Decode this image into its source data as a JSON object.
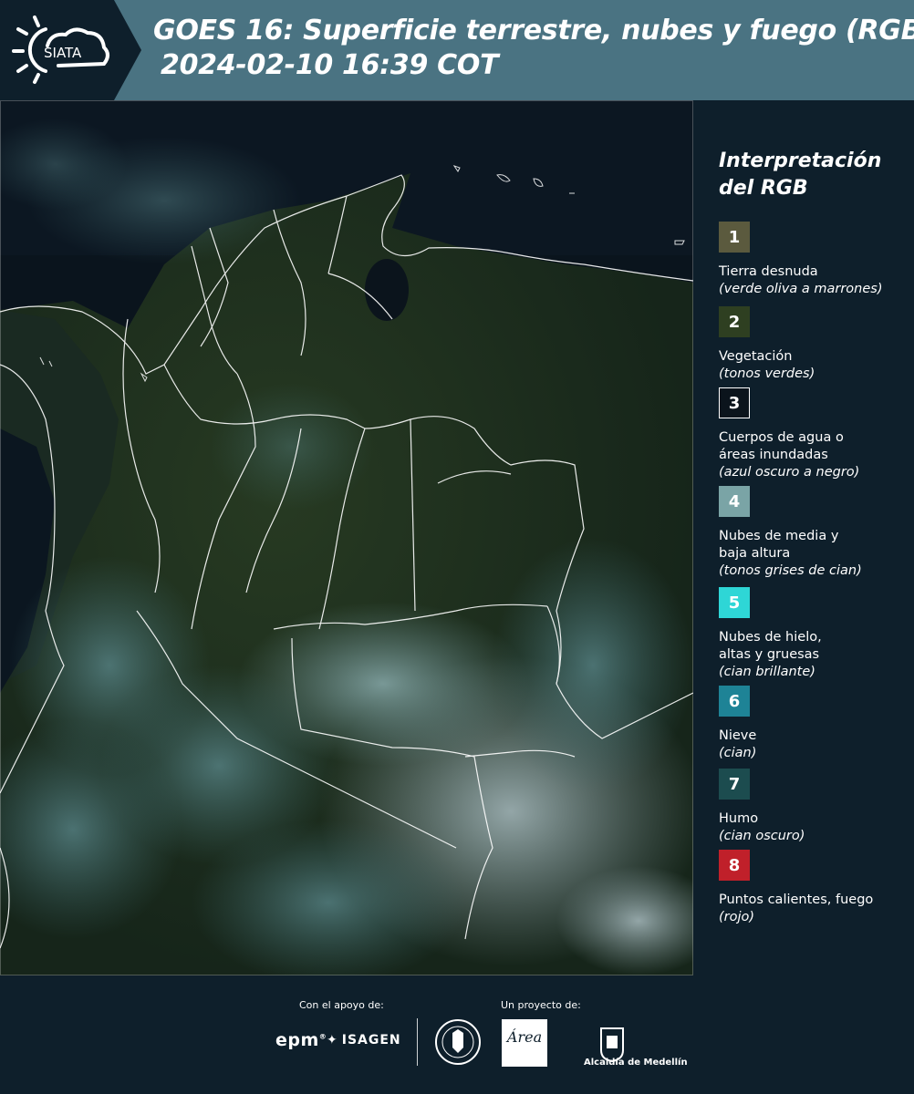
{
  "header": {
    "logo_text": "SIATA",
    "title_line1": "GOES 16: Superficie terrestre, nubes y fuego (RGB)",
    "title_line2": "2024-02-10 16:39 COT"
  },
  "legend": {
    "title_line1": "Interpretación",
    "title_line2": "del RGB",
    "items": [
      {
        "number": "1",
        "label": "Tierra desnuda",
        "note": "(verde oliva a marrones)",
        "color": "#5b5a3e",
        "border": "none"
      },
      {
        "number": "2",
        "label": "Vegetación",
        "note": "(tonos verdes)",
        "color": "#2e3f21",
        "border": "none"
      },
      {
        "number": "3",
        "label": "Cuerpos de agua o\náreas inundadas",
        "note": "(azul oscuro a negro)",
        "color": "#0b141c",
        "border": "#ffffff"
      },
      {
        "number": "4",
        "label": "Nubes de media y\nbaja altura",
        "note": "(tonos grises de cian)",
        "color": "#7aa4a6",
        "border": "none"
      },
      {
        "number": "5",
        "label": "Nubes de hielo,\naltas y gruesas",
        "note": "(cian brillante)",
        "color": "#2ed6d6",
        "border": "none"
      },
      {
        "number": "6",
        "label": "Nieve",
        "note": "(cian)",
        "color": "#1e8396",
        "border": "none"
      },
      {
        "number": "7",
        "label": "Humo",
        "note": "(cian oscuro)",
        "color": "#1c4c4f",
        "border": "none"
      },
      {
        "number": "8",
        "label": "Puntos calientes, fuego",
        "note": "(rojo)",
        "color": "#c0202a",
        "border": "none"
      }
    ]
  },
  "footer": {
    "support_label": "Con el apoyo de:",
    "project_label": "Un proyecto de:",
    "sponsor_1": "epm",
    "sponsor_2": "ISAGEN",
    "partner_1": "Área",
    "partner_2": "Alcaldía de Medellín"
  },
  "colors": {
    "header_bg": "#4a7382",
    "panel_bg": "#0e1f2b",
    "map_border": "#ffffff"
  }
}
